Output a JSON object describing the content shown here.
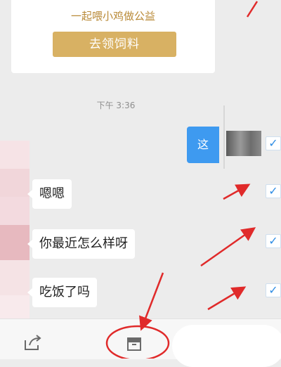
{
  "promo": {
    "text": "一起喂小鸡做公益",
    "button_label": "去领饲料"
  },
  "chat": {
    "timestamp": "下午 3:36",
    "outgoing": {
      "text": "这"
    },
    "incoming": [
      {
        "text": "嗯嗯"
      },
      {
        "text": "你最近怎么样呀"
      },
      {
        "text": "吃饭了吗"
      }
    ]
  },
  "toolbar": {
    "share_icon": "share-icon",
    "delete_icon": "trash-icon"
  },
  "colors": {
    "accent_blue": "#3e9af0",
    "promo_gold": "#d8b163",
    "annotation_red": "#e02a2a"
  }
}
